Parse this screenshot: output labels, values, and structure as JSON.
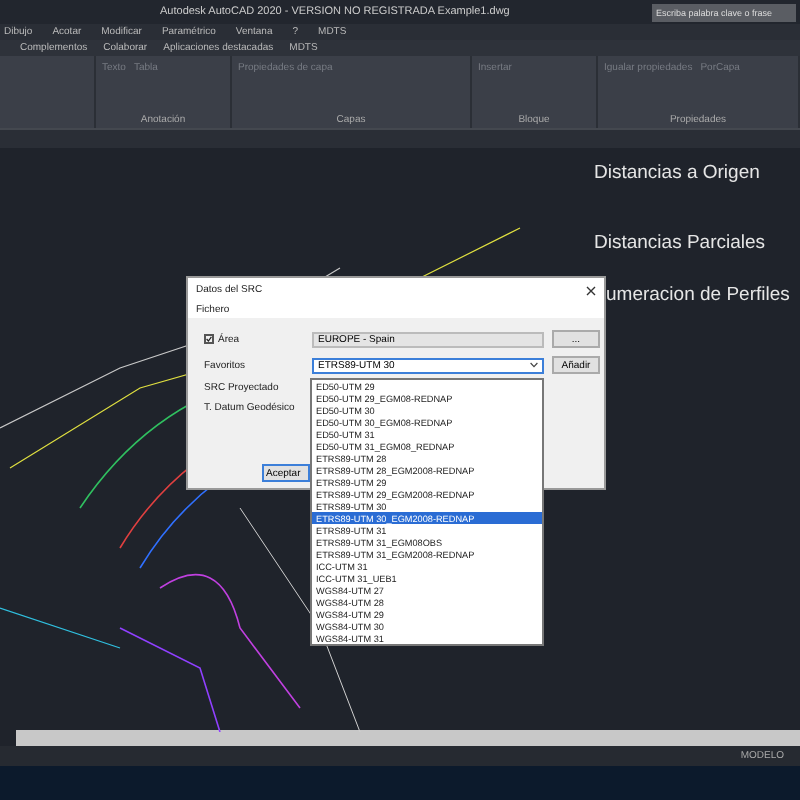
{
  "window": {
    "title": "Autodesk AutoCAD 2020 - VERSION NO REGISTRADA   Example1.dwg",
    "search": {
      "placeholder": "Escriba palabra clave o frase"
    }
  },
  "menu": [
    "Dibujo",
    "Acotar",
    "Modificar",
    "Paramétrico",
    "Ventana",
    "?",
    "MDTS"
  ],
  "tabs": [
    {
      "label": "Complementos",
      "selected": false
    },
    {
      "label": "Colaborar",
      "selected": false
    },
    {
      "label": "Aplicaciones destacadas",
      "selected": false
    },
    {
      "label": "MDTS",
      "selected": false
    }
  ],
  "ribbon": [
    {
      "title": "Anotación",
      "items": [
        "Texto",
        "Tabla"
      ]
    },
    {
      "title": "Capas",
      "items": [
        "Propiedades de capa"
      ]
    },
    {
      "title": "Bloque",
      "items": [
        "Insertar"
      ]
    },
    {
      "title": "Propiedades",
      "items": [
        "Igualar propiedades",
        "PorCapa"
      ]
    }
  ],
  "canvas_labels": [
    "Distancias a Origen",
    "Distancias Parciales",
    "umeracion de Perfiles"
  ],
  "dialog": {
    "title": "Datos del SRC",
    "menu": "Fichero",
    "area": {
      "label": "Área",
      "checked": true,
      "value": "EUROPE - Spain",
      "button": "..."
    },
    "favoritos": {
      "label": "Favoritos",
      "value": "ETRS89-UTM 30",
      "button": "Añadir"
    },
    "fields": [
      "SRC Proyectado",
      "T. Datum Geodésico"
    ],
    "ok": "Aceptar",
    "options": [
      {
        "label": "ED50-UTM 29",
        "selected": false
      },
      {
        "label": "ED50-UTM 29_EGM08-REDNAP",
        "selected": false
      },
      {
        "label": "ED50-UTM 30",
        "selected": false
      },
      {
        "label": "ED50-UTM 30_EGM08-REDNAP",
        "selected": false
      },
      {
        "label": "ED50-UTM 31",
        "selected": false
      },
      {
        "label": "ED50-UTM 31_EGM08_REDNAP",
        "selected": false
      },
      {
        "label": "ETRS89-UTM 28",
        "selected": false
      },
      {
        "label": "ETRS89-UTM 28_EGM2008-REDNAP",
        "selected": false
      },
      {
        "label": "ETRS89-UTM 29",
        "selected": false
      },
      {
        "label": "ETRS89-UTM 29_EGM2008-REDNAP",
        "selected": false
      },
      {
        "label": "ETRS89-UTM 30",
        "selected": false
      },
      {
        "label": "ETRS89-UTM 30_EGM2008-REDNAP",
        "selected": true
      },
      {
        "label": "ETRS89-UTM 31",
        "selected": false
      },
      {
        "label": "ETRS89-UTM 31_EGM08OBS",
        "selected": false
      },
      {
        "label": "ETRS89-UTM 31_EGM2008-REDNAP",
        "selected": false
      },
      {
        "label": "ICC-UTM 31",
        "selected": false
      },
      {
        "label": "ICC-UTM 31_UEB1",
        "selected": false
      },
      {
        "label": "WGS84-UTM 27",
        "selected": false
      },
      {
        "label": "WGS84-UTM 28",
        "selected": false
      },
      {
        "label": "WGS84-UTM 29",
        "selected": false
      },
      {
        "label": "WGS84-UTM 30",
        "selected": false
      },
      {
        "label": "WGS84-UTM 31",
        "selected": false
      }
    ]
  },
  "status_bar": {
    "mode": "MODELO"
  }
}
